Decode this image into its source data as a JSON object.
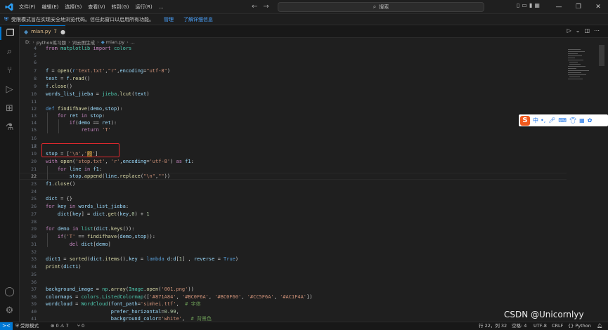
{
  "titlebar": {
    "menus": [
      "文件(F)",
      "编辑(E)",
      "选择(S)",
      "查看(V)",
      "转到(G)",
      "运行(R)",
      "..."
    ],
    "search_placeholder": "搜索"
  },
  "banner": {
    "message": "受限模式旨在实现安全地浏览代码。信任此窗口以启用所有功能。",
    "manage": "管理",
    "learn_more": "了解详细信息"
  },
  "tab": {
    "filename": "mian.py",
    "problems": "7"
  },
  "breadcrumb": [
    "D:",
    "python练习题",
    "词云图生成",
    "mian.py",
    "..."
  ],
  "code_lines": [
    {
      "n": "4",
      "code": "from matplotlib import colors"
    },
    {
      "n": "5",
      "code": ""
    },
    {
      "n": "6",
      "code": ""
    },
    {
      "n": "7",
      "code": "f = open(r'text.txt',\"r\",encoding=\"utf-8\")"
    },
    {
      "n": "8",
      "code": "text = f.read()"
    },
    {
      "n": "9",
      "code": "f.close()"
    },
    {
      "n": "10",
      "code": "words_list_jieba = jieba.lcut(text)"
    },
    {
      "n": "11",
      "code": ""
    },
    {
      "n": "12",
      "code": "def findifhave(demo,stop):"
    },
    {
      "n": "13",
      "code": "    for ret in stop:"
    },
    {
      "n": "14",
      "code": "        if(demo == ret):"
    },
    {
      "n": "15",
      "code": "            return 'T'"
    },
    {
      "n": "16",
      "code": ""
    },
    {
      "n": "17",
      "code": ""
    },
    {
      "n": "18",
      "code": ""
    },
    {
      "n": "19",
      "code": "stop = ['\\n','的']"
    },
    {
      "n": "20",
      "code": "with open('stop.txt', 'r',encoding='utf-8') as f1:"
    },
    {
      "n": "21",
      "code": "    for line in f1:"
    },
    {
      "n": "22",
      "code": "        stop.append(line.replace(\"\\n\",\"\"))"
    },
    {
      "n": "23",
      "code": "f1.close()"
    },
    {
      "n": "24",
      "code": ""
    },
    {
      "n": "25",
      "code": "dict = {}"
    },
    {
      "n": "26",
      "code": "for key in words_list_jieba:"
    },
    {
      "n": "27",
      "code": "    dict[key] = dict.get(key,0) + 1"
    },
    {
      "n": "28",
      "code": ""
    },
    {
      "n": "29",
      "code": "for demo in list(dict.keys()):"
    },
    {
      "n": "30",
      "code": "    if('T' == findifhave(demo,stop)):"
    },
    {
      "n": "31",
      "code": "        del dict[demo]"
    },
    {
      "n": "32",
      "code": ""
    },
    {
      "n": "33",
      "code": "dict1 = sorted(dict.items(),key = lambda d:d[1] , reverse = True)"
    },
    {
      "n": "34",
      "code": "print(dict1)"
    },
    {
      "n": "35",
      "code": ""
    },
    {
      "n": "36",
      "code": ""
    },
    {
      "n": "37",
      "code": "background_image = np.array(Image.open('001.png'))"
    },
    {
      "n": "38",
      "code": "colormaps = colors.ListedColormap(['#871A84', '#BC0F6A', '#BC0F60', '#CC5F6A', '#AC1F4A'])"
    },
    {
      "n": "39",
      "code": "wordcloud = WordCloud(font_path='simhei.ttf',  # 字体"
    },
    {
      "n": "40",
      "code": "                      prefer_horizontal=0.99,"
    },
    {
      "n": "41",
      "code": "                      background_color='white',  # 背景色"
    }
  ],
  "status": {
    "remote": "><",
    "restricted": "受限模式",
    "problems": "⊗ 0 ⚠ 7",
    "ports": "⑂ 0",
    "position": "行 22，列 32",
    "spaces": "空格: 4",
    "encoding": "UTF-8",
    "eol": "CRLF",
    "language": "Python"
  },
  "ime": {
    "label": "中"
  },
  "watermark": "CSDN @Unicornlyy",
  "colors": {
    "accent": "#0078d4",
    "highlight_box": "#e0282e",
    "ime_logo": "#f25a1d"
  }
}
